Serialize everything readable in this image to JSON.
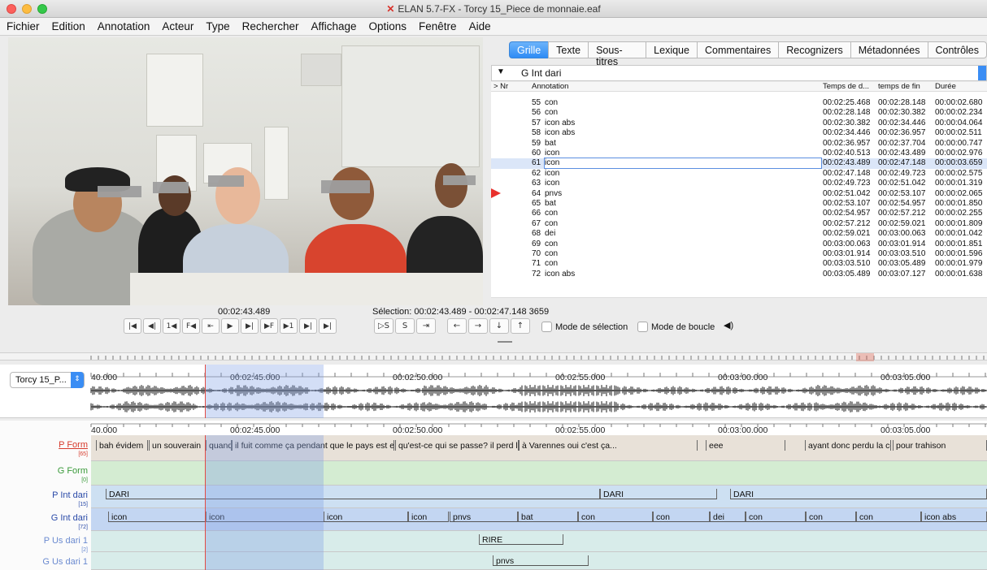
{
  "window": {
    "title": "ELAN 5.7-FX - Torcy 15_Piece de monnaie.eaf"
  },
  "menu": [
    "Fichier",
    "Edition",
    "Annotation",
    "Acteur",
    "Type",
    "Rechercher",
    "Affichage",
    "Options",
    "Fenêtre",
    "Aide"
  ],
  "player": {
    "timecode": "00:02:43.489",
    "selection": "Sélection: 00:02:43.489 - 00:02:47.148 3659"
  },
  "controls": [
    "|◀",
    "◀|",
    "1◀",
    "F◀",
    "⇤",
    "▶",
    "▶|",
    "▶F",
    "▶1",
    "▶|",
    "▶|"
  ],
  "controls2": [
    "▷S",
    "S",
    "⇥"
  ],
  "nav": [
    "←",
    "→",
    "↓",
    "↑"
  ],
  "checks": {
    "mode_selection": "Mode de sélection",
    "mode_boucle": "Mode de boucle"
  },
  "tabs": [
    "Grille",
    "Texte",
    "Sous-titres",
    "Lexique",
    "Commentaires",
    "Recognizers",
    "Métadonnées",
    "Contrôles"
  ],
  "grid": {
    "tier": "G Int dari",
    "headers": {
      "nr": "> Nr",
      "annotation": "Annotation",
      "start": "Temps de d...",
      "end": "temps de fin",
      "duration": "Durée"
    },
    "rows": [
      {
        "nr": "55",
        "ann": "con",
        "start": "00:02:25.468",
        "end": "00:02:28.148",
        "dur": "00:00:02.680"
      },
      {
        "nr": "56",
        "ann": "con",
        "start": "00:02:28.148",
        "end": "00:02:30.382",
        "dur": "00:00:02.234"
      },
      {
        "nr": "57",
        "ann": "icon abs",
        "start": "00:02:30.382",
        "end": "00:02:34.446",
        "dur": "00:00:04.064"
      },
      {
        "nr": "58",
        "ann": "icon abs",
        "start": "00:02:34.446",
        "end": "00:02:36.957",
        "dur": "00:00:02.511"
      },
      {
        "nr": "59",
        "ann": "bat",
        "start": "00:02:36.957",
        "end": "00:02:37.704",
        "dur": "00:00:00.747"
      },
      {
        "nr": "60",
        "ann": "icon",
        "start": "00:02:40.513",
        "end": "00:02:43.489",
        "dur": "00:00:02.976"
      },
      {
        "nr": "61",
        "ann": "icon",
        "start": "00:02:43.489",
        "end": "00:02:47.148",
        "dur": "00:00:03.659"
      },
      {
        "nr": "62",
        "ann": "icon",
        "start": "00:02:47.148",
        "end": "00:02:49.723",
        "dur": "00:00:02.575"
      },
      {
        "nr": "63",
        "ann": "icon",
        "start": "00:02:49.723",
        "end": "00:02:51.042",
        "dur": "00:00:01.319"
      },
      {
        "nr": "64",
        "ann": "pnvs",
        "start": "00:02:51.042",
        "end": "00:02:53.107",
        "dur": "00:00:02.065"
      },
      {
        "nr": "65",
        "ann": "bat",
        "start": "00:02:53.107",
        "end": "00:02:54.957",
        "dur": "00:00:01.850"
      },
      {
        "nr": "66",
        "ann": "con",
        "start": "00:02:54.957",
        "end": "00:02:57.212",
        "dur": "00:00:02.255"
      },
      {
        "nr": "67",
        "ann": "con",
        "start": "00:02:57.212",
        "end": "00:02:59.021",
        "dur": "00:00:01.809"
      },
      {
        "nr": "68",
        "ann": "dei",
        "start": "00:02:59.021",
        "end": "00:03:00.063",
        "dur": "00:00:01.042"
      },
      {
        "nr": "69",
        "ann": "con",
        "start": "00:03:00.063",
        "end": "00:03:01.914",
        "dur": "00:00:01.851"
      },
      {
        "nr": "70",
        "ann": "con",
        "start": "00:03:01.914",
        "end": "00:03:03.510",
        "dur": "00:00:01.596"
      },
      {
        "nr": "71",
        "ann": "con",
        "start": "00:03:03.510",
        "end": "00:03:05.489",
        "dur": "00:00:01.979"
      },
      {
        "nr": "72",
        "ann": "icon abs",
        "start": "00:03:05.489",
        "end": "00:03:07.127",
        "dur": "00:00:01.638"
      }
    ]
  },
  "waveform": {
    "media": "Torcy 15_P...",
    "ticks": [
      "40.000",
      "00:02:45.000",
      "00:02:50.000",
      "00:02:55.000",
      "00:03:00.000",
      "00:03:05.000"
    ]
  },
  "timeline": {
    "ticks": [
      "40.000",
      "00:02:45.000",
      "00:02:50.000",
      "00:02:55.000",
      "00:03:00.000",
      "00:03:05.000"
    ],
    "tiers": [
      {
        "name": "P Form",
        "count": "[65]",
        "color": "#d63a2c",
        "bg": "#e8e1d8",
        "annos": [
          "bah évidem",
          "un souverain",
          "quand",
          "il fuit comme ça pendant que le pays est e",
          "qu'est-ce qui se passe? il perd le",
          "à Varennes oui c'est ça...",
          "eee",
          "ayant donc perdu la confiance du",
          "pour trahison"
        ]
      },
      {
        "name": "G Form",
        "count": "[0]",
        "color": "#3a9a3a",
        "bg": "#d4ecd2",
        "annos": []
      },
      {
        "name": "P Int dari",
        "count": "[15]",
        "color": "#2a4aa8",
        "bg": "#cde0f2",
        "annos": [
          "DARI",
          "DARI",
          "DARI"
        ]
      },
      {
        "name": "G Int dari",
        "count": "[72]",
        "color": "#2a4aa8",
        "bg": "#c3d6f2",
        "annos": [
          "icon",
          "icon",
          "icon",
          "icon",
          "pnvs",
          "bat",
          "con",
          "con",
          "dei",
          "con",
          "con",
          "con",
          "icon abs"
        ]
      },
      {
        "name": "P Us dari 1",
        "count": "[2]",
        "color": "#6a8ad0",
        "bg": "#d8ecea",
        "annos": [
          "RIRE"
        ]
      },
      {
        "name": "G Us dari 1",
        "count": "",
        "color": "#6a8ad0",
        "bg": "#d8ecea",
        "annos": [
          "pnvs"
        ]
      }
    ]
  }
}
